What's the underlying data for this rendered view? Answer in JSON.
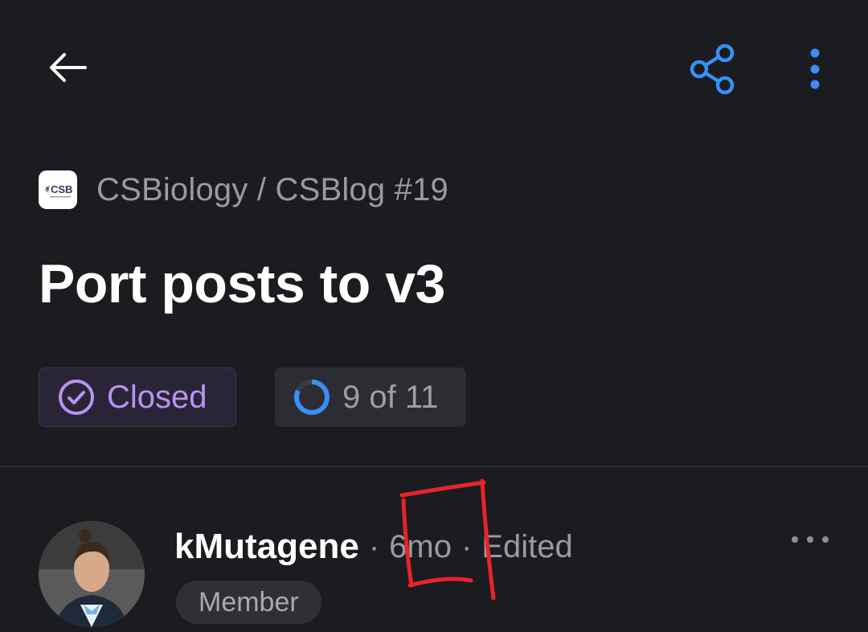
{
  "header": {
    "back_icon": "arrow-left-icon",
    "share_icon": "share-icon",
    "more_icon": "kebab-vertical-icon",
    "accent_color": "#3a8ef6"
  },
  "breadcrumb": {
    "logo_text": "CSB",
    "text": "CSBiology / CSBlog #19"
  },
  "issue": {
    "title": "Port posts to v3",
    "state": {
      "label": "Closed",
      "icon": "check-circle-icon",
      "color": "#b793f3"
    },
    "progress": {
      "label": "9 of 11",
      "done": 9,
      "total": 11,
      "icon": "progress-ring-icon",
      "color": "#3a8ef6"
    }
  },
  "comment": {
    "author": "kMutagene",
    "separator": "·",
    "time": "6mo",
    "edited": "Edited",
    "role": "Member",
    "more_icon": "kebab-horizontal-icon"
  },
  "annotation": {
    "color": "#e8232a"
  }
}
